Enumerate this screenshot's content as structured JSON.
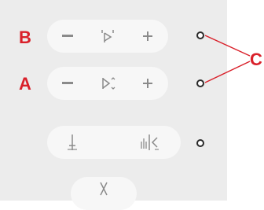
{
  "callouts": {
    "b": "B",
    "a": "A",
    "c": "C"
  },
  "rows": [
    {
      "name": "stitch-width",
      "buttons": [
        {
          "icon": "minus-icon"
        },
        {
          "icon": "stitch-width-icon"
        },
        {
          "icon": "plus-icon"
        }
      ]
    },
    {
      "name": "stitch-length",
      "buttons": [
        {
          "icon": "minus-icon"
        },
        {
          "icon": "stitch-length-icon"
        },
        {
          "icon": "plus-icon"
        }
      ]
    },
    {
      "name": "needle-thread",
      "buttons": [
        {
          "icon": "needle-stop-icon"
        },
        {
          "icon": "thread-tension-icon"
        }
      ]
    },
    {
      "name": "cut",
      "buttons": [
        {
          "icon": "scissors-icon"
        }
      ]
    }
  ],
  "colors": {
    "callout": "#d9202a",
    "panel": "#ececec",
    "pill": "#f7f7f7",
    "icon": "#8a8a8a"
  }
}
